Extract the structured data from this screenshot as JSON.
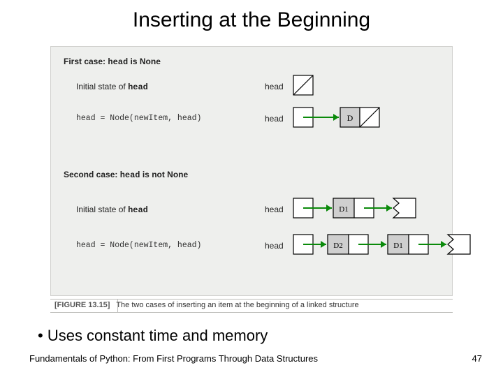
{
  "title": "Inserting at the Beginning",
  "figure": {
    "case1_label": "First case: head is None",
    "case2_label": "Second case: head is not None",
    "initial_label": "Initial state of",
    "head_word": "head",
    "code_line": "head = Node(newItem, head)",
    "node_D": "D",
    "node_D1": "D1",
    "node_D2": "D2"
  },
  "caption_tag": "[FIGURE 13.15]",
  "caption_text": "The two cases of inserting an item at the beginning of a linked structure",
  "bullet": "•  Uses constant time and memory",
  "footer": "Fundamentals of Python: From First Programs Through Data Structures",
  "page_number": "47",
  "chart_data": null
}
